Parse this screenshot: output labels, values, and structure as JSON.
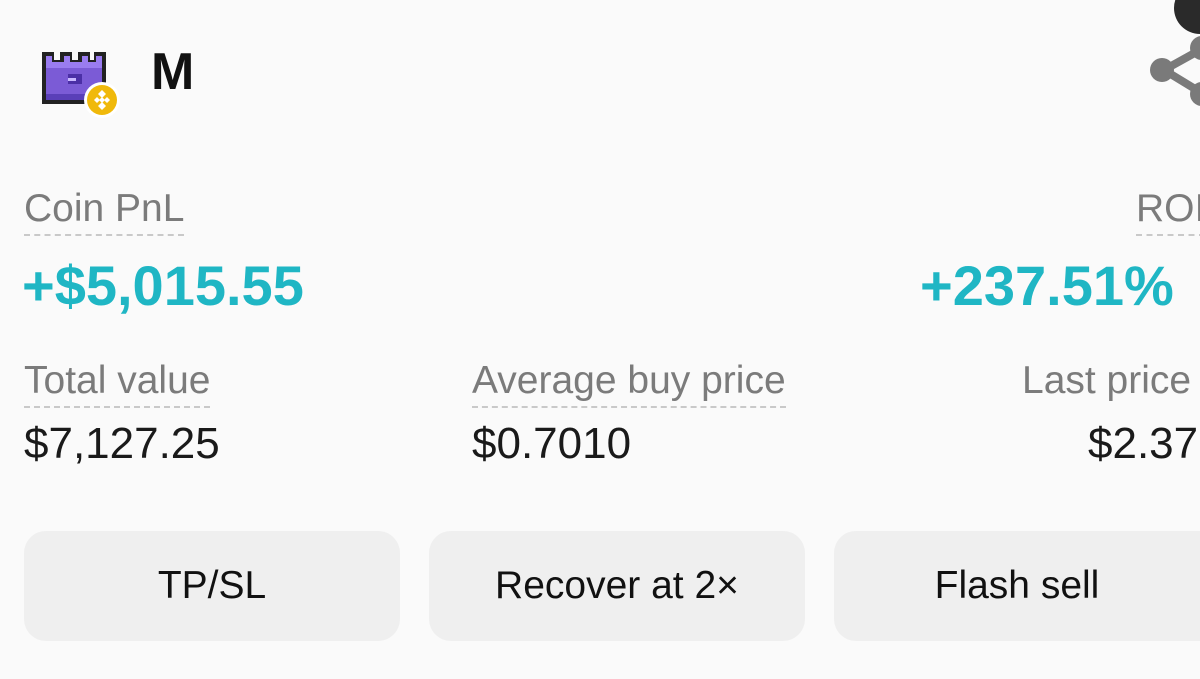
{
  "header": {
    "coin_name": "M",
    "logo_icon": "pixel-castle-logo-icon",
    "chain_badge_icon": "bnb-chain-badge-icon",
    "share_icon": "share-icon"
  },
  "stats": {
    "coin_pnl_label": "Coin PnL",
    "coin_pnl_value": "+$5,015.55",
    "roi_label": "ROI",
    "roi_value": "+237.51%",
    "total_value_label": "Total value",
    "total_value": "$7,127.25",
    "avg_buy_price_label": "Average buy price",
    "avg_buy_price": "$0.7010",
    "last_price_label": "Last price",
    "last_price": "$2.37"
  },
  "actions": {
    "tpsl_label": "TP/SL",
    "recover_label": "Recover at 2×",
    "flash_sell_label": "Flash sell"
  },
  "colors": {
    "positive": "#1fb6c4",
    "label": "#7b7b7b",
    "button_bg": "#efefef",
    "logo_purple": "#7b5bd6",
    "badge_gold": "#f0b90b"
  }
}
